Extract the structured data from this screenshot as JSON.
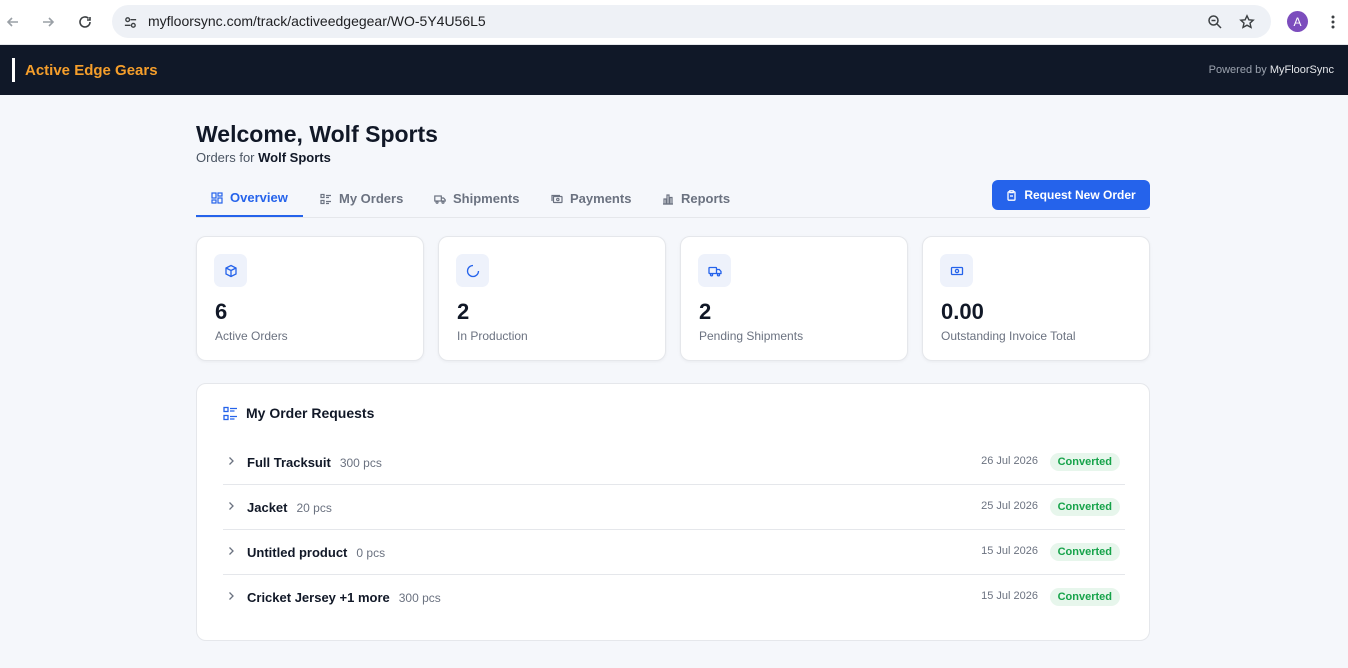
{
  "browser": {
    "url": "myfloorsync.com/track/activeedgegear/WO-5Y4U56L5",
    "avatar_letter": "A",
    "icons": [
      "back-arrow-icon",
      "forward-arrow-icon",
      "reload-icon",
      "site-settings-icon",
      "zoom-icon",
      "star-icon",
      "kebab-menu-icon"
    ]
  },
  "header": {
    "brand": "Active Edge Gears",
    "powered_prefix": "Powered by",
    "powered_name": "MyFloorSync",
    "brand_color": "#f59e2b",
    "bg_color": "#101828"
  },
  "welcome": {
    "title": "Welcome, Wolf Sports",
    "subtitle_prefix": "Orders for",
    "subtitle_client": "Wolf Sports"
  },
  "tabs": [
    {
      "label": "Overview",
      "icon": "dashboard-icon",
      "active": true
    },
    {
      "label": "My Orders",
      "icon": "list-icon",
      "active": false
    },
    {
      "label": "Shipments",
      "icon": "truck-icon",
      "active": false
    },
    {
      "label": "Payments",
      "icon": "payment-icon",
      "active": false
    },
    {
      "label": "Reports",
      "icon": "bar-chart-icon",
      "active": false
    }
  ],
  "actions": {
    "request_new_order": "Request New Order",
    "accent_color": "#2563eb"
  },
  "stats": [
    {
      "value": "6",
      "label": "Active Orders",
      "icon": "box-icon"
    },
    {
      "value": "2",
      "label": "In Production",
      "icon": "spinner-icon"
    },
    {
      "value": "2",
      "label": "Pending Shipments",
      "icon": "truck-icon"
    },
    {
      "value": "0.00",
      "label": "Outstanding Invoice Total",
      "icon": "cash-icon"
    }
  ],
  "orders": {
    "title": "My Order Requests",
    "rows": [
      {
        "name": "Full Tracksuit",
        "qty": "300 pcs",
        "date": "26 Jul 2026",
        "status": "Converted"
      },
      {
        "name": "Jacket",
        "qty": "20 pcs",
        "date": "25 Jul 2026",
        "status": "Converted"
      },
      {
        "name": "Untitled product",
        "qty": "0 pcs",
        "date": "15 Jul 2026",
        "status": "Converted"
      },
      {
        "name": "Cricket Jersey +1 more",
        "qty": "300 pcs",
        "date": "15 Jul 2026",
        "status": "Converted"
      }
    ],
    "status_color": "#16a34a"
  }
}
